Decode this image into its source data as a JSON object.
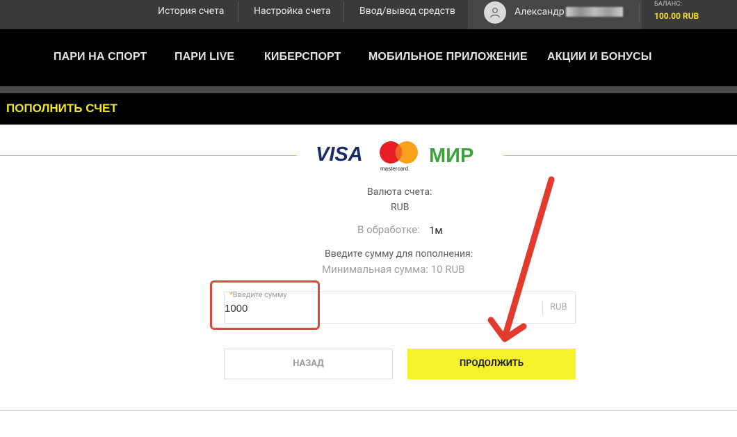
{
  "topbar": {
    "links": [
      "История счета",
      "Настройка счета",
      "Ввод/вывод средств"
    ],
    "username": "Александр",
    "balance_label": "БАЛАНС:",
    "balance_value": "100.00 RUB"
  },
  "nav": {
    "items": [
      "ПАРИ НА СПОРТ",
      "ПАРИ LIVE",
      "КИБЕРСПОРТ",
      "МОБИЛЬНОЕ ПРИЛОЖЕНИЕ",
      "АКЦИИ И БОНУСЫ"
    ]
  },
  "page": {
    "title": "ПОПОЛНИТЬ СЧЕТ"
  },
  "payment": {
    "logos": {
      "visa": "VISA",
      "mastercard": "mastercard.",
      "mir": "МИР"
    },
    "currency_label": "Валюта счета:",
    "currency_value": "RUB",
    "processing_label": "В обработке:",
    "processing_value": "1м",
    "enter_amount_label": "Введите сумму для пополнения:",
    "min_amount": "Минимальная сумма: 10 RUB"
  },
  "amount_input": {
    "required_mark": "*",
    "label": "Введите сумму",
    "value": "1000",
    "currency": "RUB"
  },
  "buttons": {
    "back": "НАЗАД",
    "continue": "ПРОДОЛЖИТЬ"
  },
  "colors": {
    "accent_yellow": "#f5f22a",
    "highlight_red": "#d94a3a",
    "header_black": "#000000"
  },
  "icons": [
    "user-icon",
    "arrow-pointer-icon"
  ]
}
